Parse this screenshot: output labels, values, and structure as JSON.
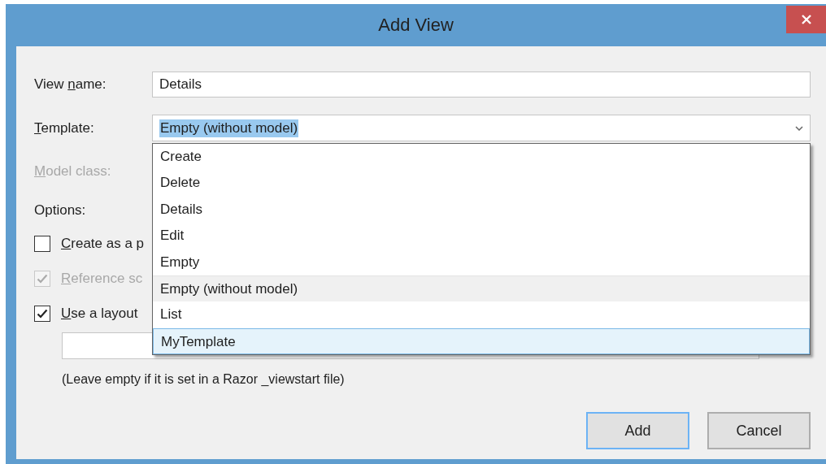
{
  "window": {
    "title": "Add View"
  },
  "view_name": {
    "label": {
      "pre": "View ",
      "key": "n",
      "post": "ame:"
    },
    "value": "Details"
  },
  "template": {
    "label": {
      "key": "T",
      "post": "emplate:"
    },
    "value": "Empty (without model)",
    "text_selected": true,
    "options": [
      {
        "label": "Create",
        "selected": false,
        "highlighted": false
      },
      {
        "label": "Delete",
        "selected": false,
        "highlighted": false
      },
      {
        "label": "Details",
        "selected": false,
        "highlighted": false
      },
      {
        "label": "Edit",
        "selected": false,
        "highlighted": false
      },
      {
        "label": "Empty",
        "selected": false,
        "highlighted": false
      },
      {
        "label": "Empty (without model)",
        "selected": true,
        "highlighted": false
      },
      {
        "label": "List",
        "selected": false,
        "highlighted": false
      },
      {
        "label": "MyTemplate",
        "selected": false,
        "highlighted": true
      }
    ]
  },
  "model_class": {
    "label": {
      "key": "M",
      "post": "odel class:"
    },
    "disabled": true
  },
  "options_label": "Options:",
  "checkboxes": [
    {
      "label": {
        "key": "C",
        "post": "reate as a p"
      },
      "checked": false,
      "disabled": false
    },
    {
      "label": {
        "key": "R",
        "post": "eference sc"
      },
      "checked": true,
      "disabled": true
    },
    {
      "label": {
        "key": "U",
        "post": "se a layout"
      },
      "checked": true,
      "disabled": false
    }
  ],
  "note": "(Leave empty if it is set in a Razor _viewstart file)",
  "buttons": [
    {
      "label": "Add",
      "default": true
    },
    {
      "label": "Cancel",
      "default": false
    }
  ]
}
